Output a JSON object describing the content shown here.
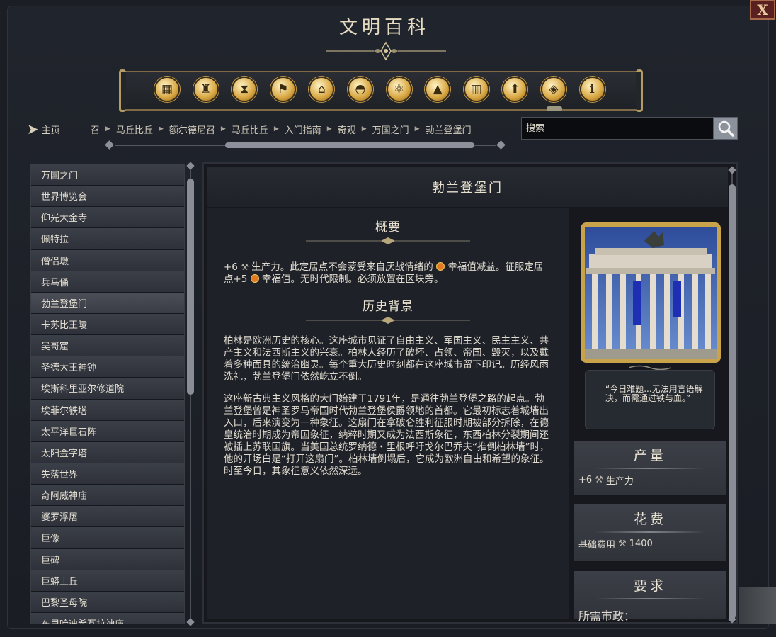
{
  "window": {
    "title": "文明百科",
    "close_label": "X"
  },
  "categories": [
    {
      "name": "cubes-icon"
    },
    {
      "name": "goblet-icon"
    },
    {
      "name": "hourglass-icon"
    },
    {
      "name": "flag-icon"
    },
    {
      "name": "temple-icon"
    },
    {
      "name": "dome-icon"
    },
    {
      "name": "atom-icon"
    },
    {
      "name": "mountain-icon"
    },
    {
      "name": "building-icon"
    },
    {
      "name": "up-arrow-icon"
    },
    {
      "name": "book-icon"
    },
    {
      "name": "info-icon"
    }
  ],
  "nav": {
    "home_label": "主页",
    "breadcrumbs": [
      "召",
      "马丘比丘",
      "额尔德尼召",
      "马丘比丘",
      "入门指南",
      "奇观",
      "万国之门",
      "勃兰登堡门"
    ],
    "search_placeholder": "搜索"
  },
  "list": {
    "items": [
      "万国之门",
      "世界博览会",
      "仰光大金寺",
      "佩特拉",
      "僧侣墩",
      "兵马俑",
      "勃兰登堡门",
      "卡苏比王陵",
      "吴哥窟",
      "圣德大王神钟",
      "埃斯科里亚尔修道院",
      "埃菲尔铁塔",
      "太平洋巨石阵",
      "太阳金字塔",
      "失落世界",
      "奇阿威神庙",
      "婆罗浮屠",
      "巨像",
      "巨碑",
      "巨蟒土丘",
      "巴黎圣母院",
      "布里哈迪希瓦拉神庙"
    ],
    "active_index": 6
  },
  "article": {
    "title": "勃兰登堡门",
    "summary_title": "概要",
    "summary": {
      "p1_a": "+6",
      "p1_b": "生产力。此定居点不会蒙受来自厌战情绪的",
      "p1_c": "幸福值减益。征服定居点+5",
      "p1_d": "幸福值。无时代限制。必须放置在区块旁。"
    },
    "history_title": "历史背景",
    "history_p1": "柏林是欧洲历史的核心。这座城市见证了自由主义、军国主义、民主主义、共产主义和法西斯主义的兴衰。柏林人经历了破坏、占领、帝国、毁灭，以及戴着多种面具的统治幽灵。每个重大历史时刻都在这座城市留下印记。历经风雨洗礼，勃兰登堡门依然屹立不倒。",
    "history_p2": "这座新古典主义风格的大门始建于1791年，是通往勃兰登堡之路的起点。勃兰登堡曾是神圣罗马帝国时代勃兰登堡侯爵领地的首都。它最初标志着城墙出入口，后来演变为一种象征。这扇门在拿破仑胜利征服时期被部分拆除，在德皇统治时期成为帝国象征，纳粹时期又成为法西斯象征，东西柏林分裂期间还被插上苏联国旗。当美国总统罗纳德・里根呼吁戈尔巴乔夫“推倒柏林墙”时，他的开场白是“打开这扇门”。柏林墙倒塌后，它成为欧洲自由和希望的象征。时至今日，其象征意义依然深远。"
  },
  "sidebar": {
    "quote": "“今日难题...无法用言语解决，而需通过铁与血。”",
    "yield_title": "产量",
    "yield_value": "+6",
    "yield_label": "生产力",
    "cost_title": "花费",
    "cost_label": "基础费用",
    "cost_value": "1400",
    "req_title": "要求",
    "req_label": "所需市政："
  },
  "colors": {
    "accent_gold": "#c9a34a",
    "panel": "#3c3f47",
    "background": "#1b1e25"
  }
}
